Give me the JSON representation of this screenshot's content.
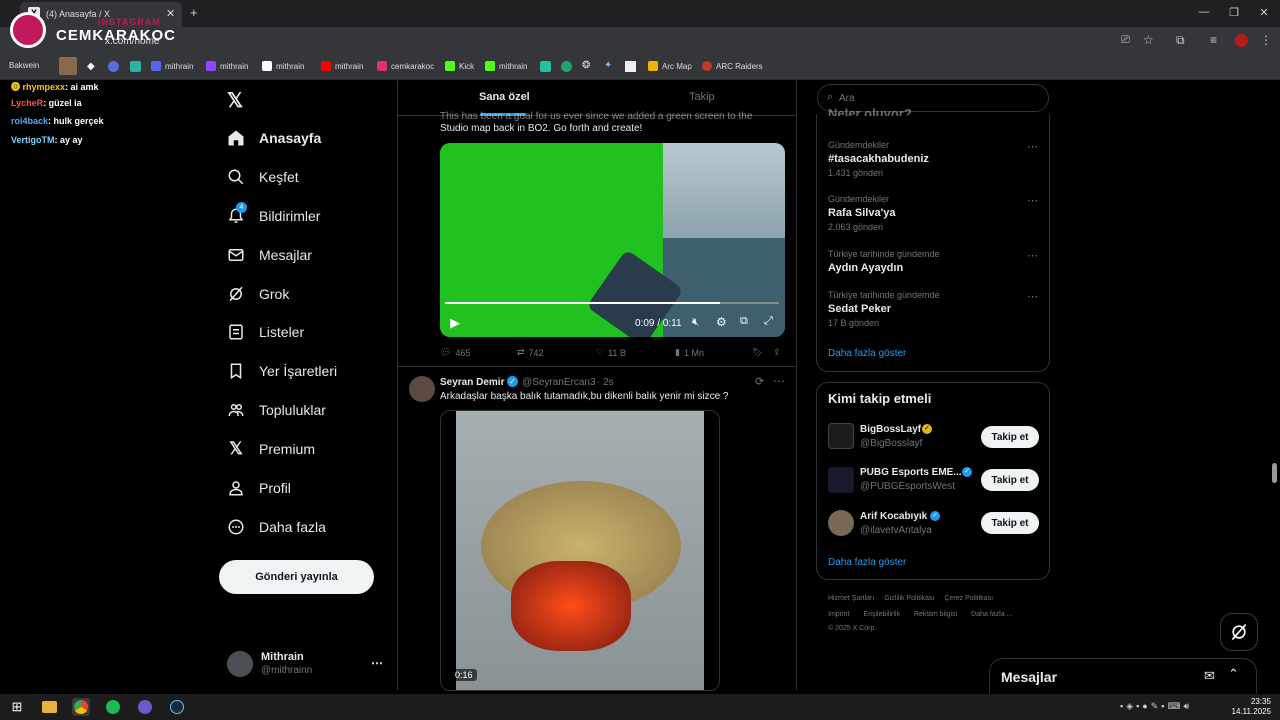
{
  "browser": {
    "tab_title": "(4) Anasayfa / X",
    "url": "x.com/home",
    "new_tab": "+",
    "bookmarks": [
      {
        "label": "Bakwein",
        "color": "#d8a26b"
      },
      {
        "label": "mithrain",
        "color": "#5865f2"
      },
      {
        "label": "mithrain",
        "color": "#9146ff"
      },
      {
        "label": "mithrain",
        "color": "#ffffff"
      },
      {
        "label": "mithrain",
        "color": "#ff0000"
      },
      {
        "label": "cemkarakoc",
        "color": "#e1306c"
      },
      {
        "label": "Kick",
        "color": "#53fc18"
      },
      {
        "label": "mithrain",
        "color": "#53fc18"
      },
      {
        "label": "Arc Map",
        "color": "#f0b400"
      },
      {
        "label": "ARC Raiders",
        "color": "#c0392b"
      }
    ]
  },
  "overlay": {
    "brand_small": "INSTAGRAM",
    "brand_big": "CEMKARAKOC"
  },
  "chat": [
    {
      "user": "rhympexx",
      "msg": ": ai amk",
      "color": "#f5c518"
    },
    {
      "user": "LycheR",
      "msg": ": güzel ia",
      "color": "#ff4d4d"
    },
    {
      "user": "roi4back",
      "msg": ": hulk gerçek",
      "color": "#5aa9ff"
    },
    {
      "user": "VertigoTM",
      "msg": ": ay ay",
      "color": "#7ad3ff"
    }
  ],
  "nav": {
    "items": [
      {
        "label": "Anasayfa",
        "icon": "home-icon"
      },
      {
        "label": "Keşfet",
        "icon": "search-icon"
      },
      {
        "label": "Bildirimler",
        "icon": "bell-icon",
        "badge": "4"
      },
      {
        "label": "Mesajlar",
        "icon": "mail-icon"
      },
      {
        "label": "Grok",
        "icon": "grok-icon"
      },
      {
        "label": "Listeler",
        "icon": "list-icon"
      },
      {
        "label": "Yer İşaretleri",
        "icon": "bookmark-icon"
      },
      {
        "label": "Topluluklar",
        "icon": "communities-icon"
      },
      {
        "label": "Premium",
        "icon": "x-logo-icon"
      },
      {
        "label": "Profil",
        "icon": "profile-icon"
      },
      {
        "label": "Daha fazla",
        "icon": "more-circle-icon"
      }
    ],
    "post_button": "Gönderi yayınla",
    "account": {
      "name": "Mithrain",
      "handle": "@mithrainn"
    }
  },
  "timeline": {
    "tabs": [
      "Sana özel",
      "Takip"
    ],
    "tweet1": {
      "text_cut": "This has been a goal for us ever since we added a green screen to the",
      "text": "Studio map back in BO2. Go forth and create!",
      "video_time": "0:09 / 0:11",
      "replies": "465",
      "reposts": "742",
      "likes": "11 B",
      "views": "1 Mn"
    },
    "tweet2": {
      "name": "Seyran Demir",
      "handle": "@SeyranErcan3",
      "time": "· 2s",
      "text": "Arkadaşlar başka balık tutamadık,bu dikenli balık yenir mi sizce ?",
      "video_time": "0:16"
    }
  },
  "sidebar": {
    "search_placeholder": "Ara",
    "trends_title": "Neler oluyor?",
    "trends": [
      {
        "section": "Gündemdekiler",
        "title": "#tasacakhabudeniz",
        "count": "1.431 gönderi"
      },
      {
        "section": "Gündemdekiler",
        "title": "Rafa Silva'ya",
        "count": "2.063 gönderi"
      },
      {
        "section": "Türkiye tarihinde gündemde",
        "title": "Aydın Ayaydın",
        "count": ""
      },
      {
        "section": "Türkiye tarihinde gündemde",
        "title": "Sedat Peker",
        "count": "17 B gönderi"
      }
    ],
    "show_more": "Daha fazla göster",
    "who_title": "Kimi takip etmeli",
    "who": [
      {
        "name": "BigBossLayf",
        "handle": "@BigBosslayf",
        "verified_color": "#e2b719"
      },
      {
        "name": "PUBG Esports EME...",
        "handle": "@PUBGEsportsWest",
        "verified_color": "#1d9bf0"
      },
      {
        "name": "Arif Kocabıyık",
        "handle": "@ilavetvAntalya",
        "verified_color": "#1d9bf0"
      }
    ],
    "follow_label": "Takip et",
    "who_more": "Daha fazla göster",
    "footer_row1": [
      "Hizmet Şartları",
      "Gizlilik Politikası",
      "Çerez Politikası"
    ],
    "footer_row2": [
      "Imprint",
      "Erişilebilirlik",
      "Reklam bilgisi",
      "Daha fazla ..."
    ],
    "copyright": "© 2025 X Corp."
  },
  "messages_dock": {
    "title": "Mesajlar"
  },
  "taskbar": {
    "time": "23:35",
    "date": "14.11.2025"
  },
  "colors": {
    "accent": "#1d9bf0",
    "bg": "#000000",
    "border": "#2f3336"
  }
}
